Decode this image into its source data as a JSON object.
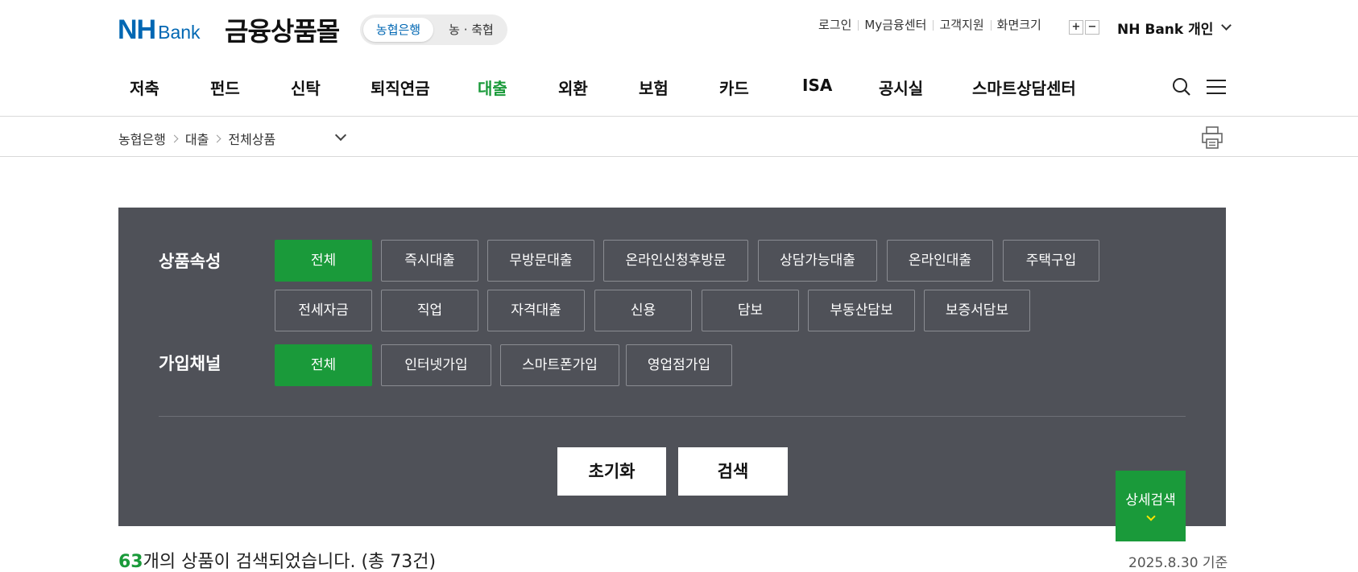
{
  "header": {
    "logo_nh": "NH",
    "logo_bank": "Bank",
    "site_title": "금융상품몰",
    "toggle": {
      "active": "농협은행",
      "inactive": "농 · 축협"
    },
    "util_links": [
      "로그인",
      "My금융센터",
      "고객지원",
      "화면크기"
    ],
    "zoom_in": "+",
    "zoom_out": "−",
    "personal_label": "NH Bank 개인"
  },
  "gnb": {
    "items": [
      "저축",
      "펀드",
      "신탁",
      "퇴직연금",
      "대출",
      "외환",
      "보험",
      "카드",
      "ISA",
      "공시실",
      "스마트상담센터"
    ],
    "active_index": 4
  },
  "breadcrumb": [
    "농협은행",
    "대출",
    "전체상품"
  ],
  "filter": {
    "attr_label": "상품속성",
    "attr_chips": [
      "전체",
      "즉시대출",
      "무방문대출",
      "온라인신청후방문",
      "상담가능대출",
      "온라인대출",
      "주택구입",
      "전세자금",
      "직업",
      "자격대출",
      "신용",
      "담보",
      "부동산담보",
      "보증서담보"
    ],
    "channel_label": "가입채널",
    "channel_chips": [
      "전체",
      "인터넷가입",
      "스마트폰가입",
      "영업점가입"
    ],
    "reset_label": "초기화",
    "search_label": "검색",
    "detail_label": "상세검색"
  },
  "result": {
    "count": "63",
    "text": "개의 상품이 검색되었습니다. (총 73건)",
    "basis_date": "2025.8.30",
    "basis_suffix": " 기준"
  },
  "colors": {
    "brand_blue": "#0067b3",
    "accent_green": "#1a9a3a",
    "panel_bg": "#4f5158",
    "detail_chevron": "#ffe400"
  }
}
